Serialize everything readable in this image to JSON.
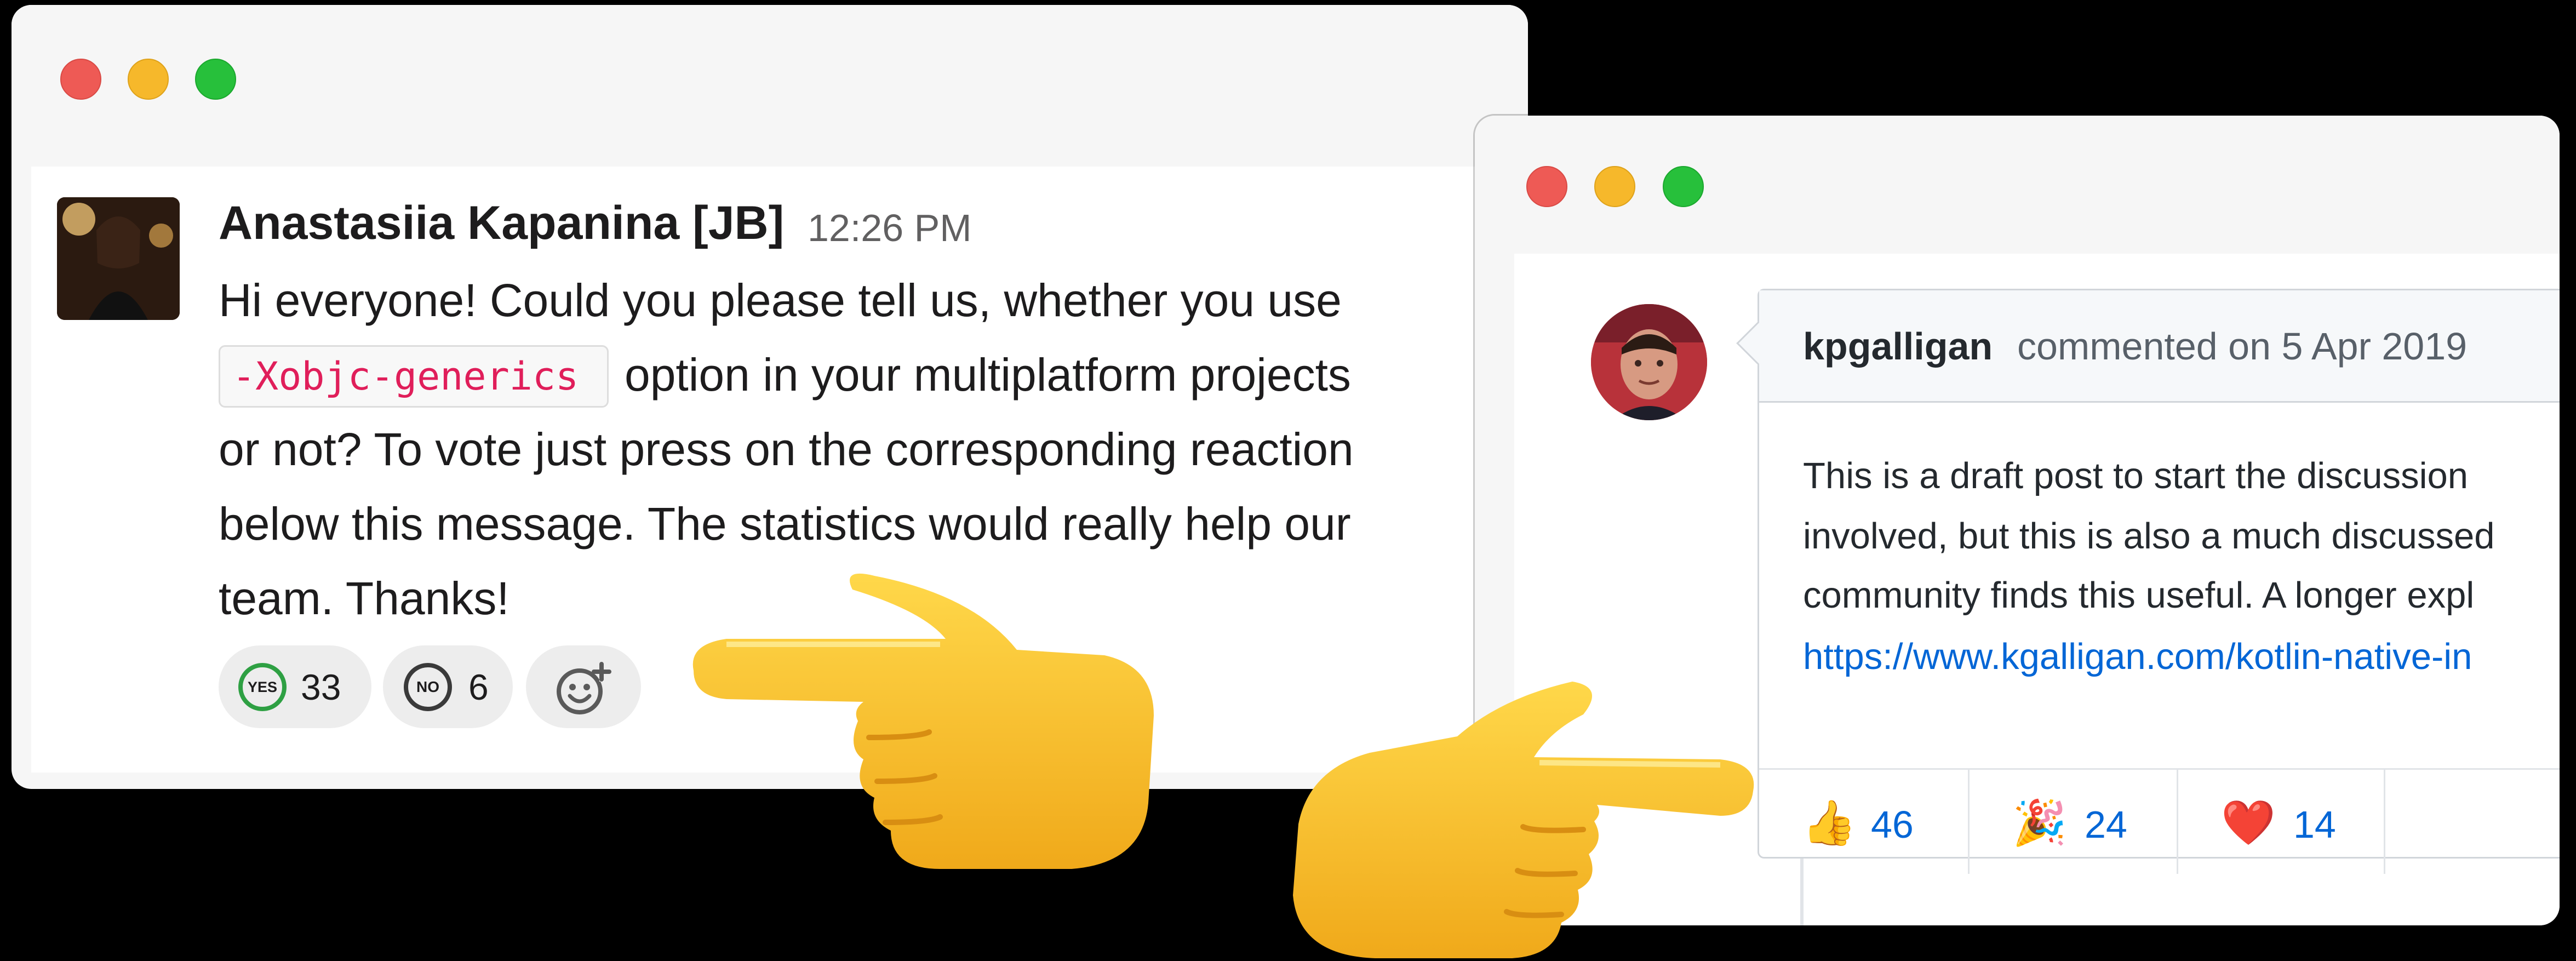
{
  "slack": {
    "author": "Anastasiia Kapanina [JB]",
    "time": "12:26 PM",
    "message_lines": [
      "Hi everyone! Could you please tell us, whether you use",
      "option in your multiplatform projects",
      "or not? To vote just press on the corresponding reaction",
      "below this message. The statistics would really help our",
      "team.  Thanks!"
    ],
    "code": "-Xobjc-generics",
    "reactions": [
      {
        "badge": "YES",
        "count": "33",
        "color": "#2ea043"
      },
      {
        "badge": "NO",
        "count": "6",
        "color": "#3a3a3a"
      }
    ],
    "add_reaction_icon": "add-emoji-icon"
  },
  "github": {
    "author": "kpgalligan",
    "meta": "commented on 5 Apr 2019",
    "body_lines": [
      "This is a draft post to start the discussion",
      "involved, but this is also a much discussed",
      "community finds this useful. A longer expl"
    ],
    "link": "https://www.kgalligan.com/kotlin-native-in",
    "reactions": [
      {
        "emoji": "👍",
        "count": "46"
      },
      {
        "emoji": "🎉",
        "count": "24"
      },
      {
        "emoji": "❤️",
        "count": "14"
      }
    ]
  },
  "colors": {
    "close": "#ee5a55",
    "minimize": "#f6b82b",
    "zoom": "#27c03b",
    "slack_code": "#e01e5a",
    "github_link": "#0366d6"
  }
}
